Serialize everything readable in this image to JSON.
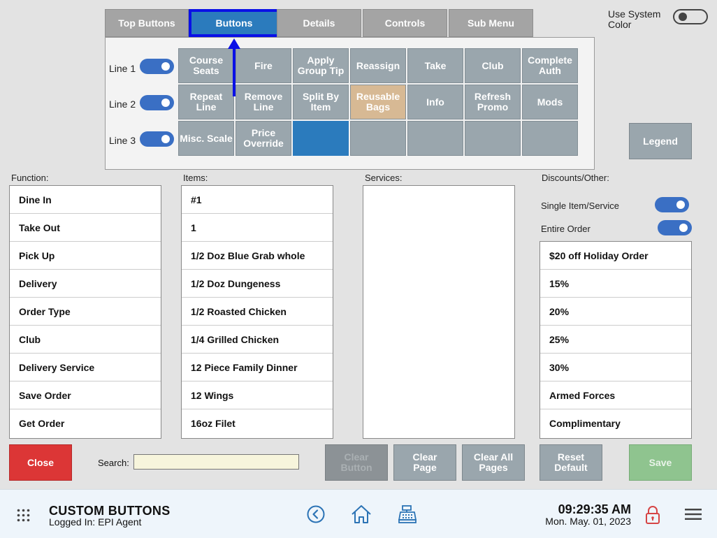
{
  "tabs": [
    "Top Buttons",
    "Buttons",
    "Details",
    "Controls",
    "Sub Menu"
  ],
  "system_color": {
    "label": "Use System Color"
  },
  "lines": [
    "Line 1",
    "Line 2",
    "Line 3"
  ],
  "grid": [
    "Course Seats",
    "Fire",
    "Apply Group Tip",
    "Reassign",
    "Take",
    "Club",
    "Complete Auth",
    "Repeat Line",
    "Remove Line",
    "Split By Item",
    "Reusable Bags",
    "Info",
    "Refresh Promo",
    "Mods",
    "Misc. Scale",
    "Price Override",
    "",
    "",
    "",
    "",
    ""
  ],
  "legend_label": "Legend",
  "columns": {
    "function": "Function:",
    "items": "Items:",
    "services": "Services:",
    "discounts": "Discounts/Other:"
  },
  "function_list": [
    "Dine In",
    "Take Out",
    "Pick Up",
    "Delivery",
    "Order Type",
    "Club",
    "Delivery Service",
    "Save Order",
    "Get Order"
  ],
  "items_list": [
    "#1",
    "1",
    "1/2 Doz Blue Grab whole",
    "1/2 Doz Dungeness",
    "1/2 Roasted Chicken",
    "1/4 Grilled Chicken",
    "12 Piece Family Dinner",
    "12 Wings",
    "16oz Filet"
  ],
  "discount_toggles": {
    "single": "Single Item/Service",
    "entire": "Entire Order"
  },
  "discount_list": [
    "$20 off Holiday Order",
    "15%",
    "20%",
    "25%",
    "30%",
    "Armed Forces",
    "Complimentary"
  ],
  "buttons": {
    "close": "Close",
    "search_label": "Search:",
    "clear_button": "Clear Button",
    "clear_page": "Clear Page",
    "clear_all_pages": "Clear All Pages",
    "reset_default": "Reset Default",
    "save": "Save"
  },
  "footer": {
    "title": "CUSTOM BUTTONS",
    "logged_in_label": "Logged In:",
    "user": "EPI Agent",
    "time": "09:29:35 AM",
    "date": "Mon. May. 01, 2023"
  },
  "colors": {
    "accent": "#2b7bbd",
    "close": "#dc3636",
    "save": "#8fc48f",
    "toggle": "#3a6fc4",
    "tan": "#d7b994"
  }
}
